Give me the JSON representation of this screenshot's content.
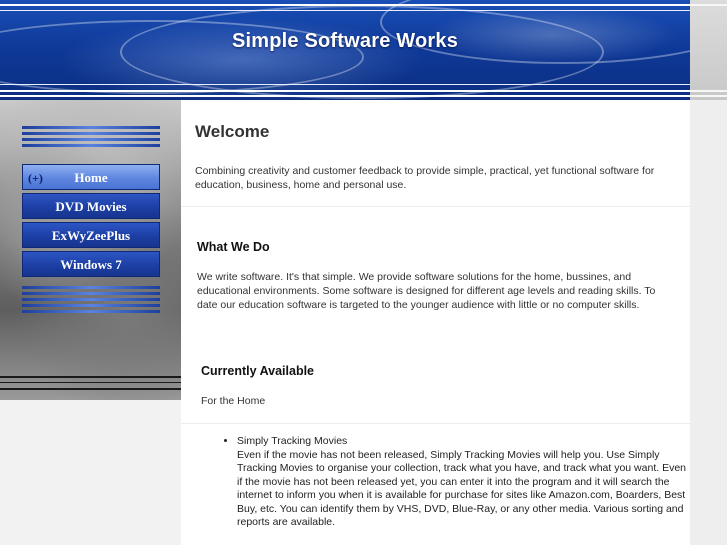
{
  "header": {
    "title": "Simple Software Works"
  },
  "sidebar": {
    "items": [
      {
        "label": "Home",
        "icon_text": "(+)",
        "active": true
      },
      {
        "label": "DVD Movies",
        "active": false
      },
      {
        "label": "ExWyZeePlus",
        "active": false
      },
      {
        "label": "Windows 7",
        "active": false
      }
    ]
  },
  "main": {
    "welcome_heading": "Welcome",
    "intro_text": "Combining creativity and customer feedback to provide simple, practical, yet functional software for education, business, home and personal use.",
    "what_we_do_heading": "What We Do",
    "what_we_do_text": "We write software.  It's that simple.  We provide software solutions for the home, bussines, and educational environments.  Some software is designed for different age levels and reading skills.  To date our education software is targeted to the younger audience with little or no computer skills.",
    "currently_available_heading": "Currently Available",
    "for_the_home": "For the Home",
    "products": [
      {
        "name": "Simply Tracking Movies",
        "description": "Even if the movie has not been released, Simply Tracking Movies will help you.  Use Simply Tracking Movies to organise your collection, track what you have, and track what you want.  Even if the movie has not been released yet, you can enter it into the program and it will search the internet to inform you when it is available for purchase for sites like Amazon.com, Boarders, Best Buy, etc.  You can identify them by VHS, DVD, Blue-Ray, or any other media.  Various sorting and reports are available."
      }
    ]
  },
  "colors": {
    "header_blue": "#1a4fb6",
    "nav_blue": "#1c3ea3",
    "nav_active": "#5e86e0",
    "text": "#333333"
  }
}
